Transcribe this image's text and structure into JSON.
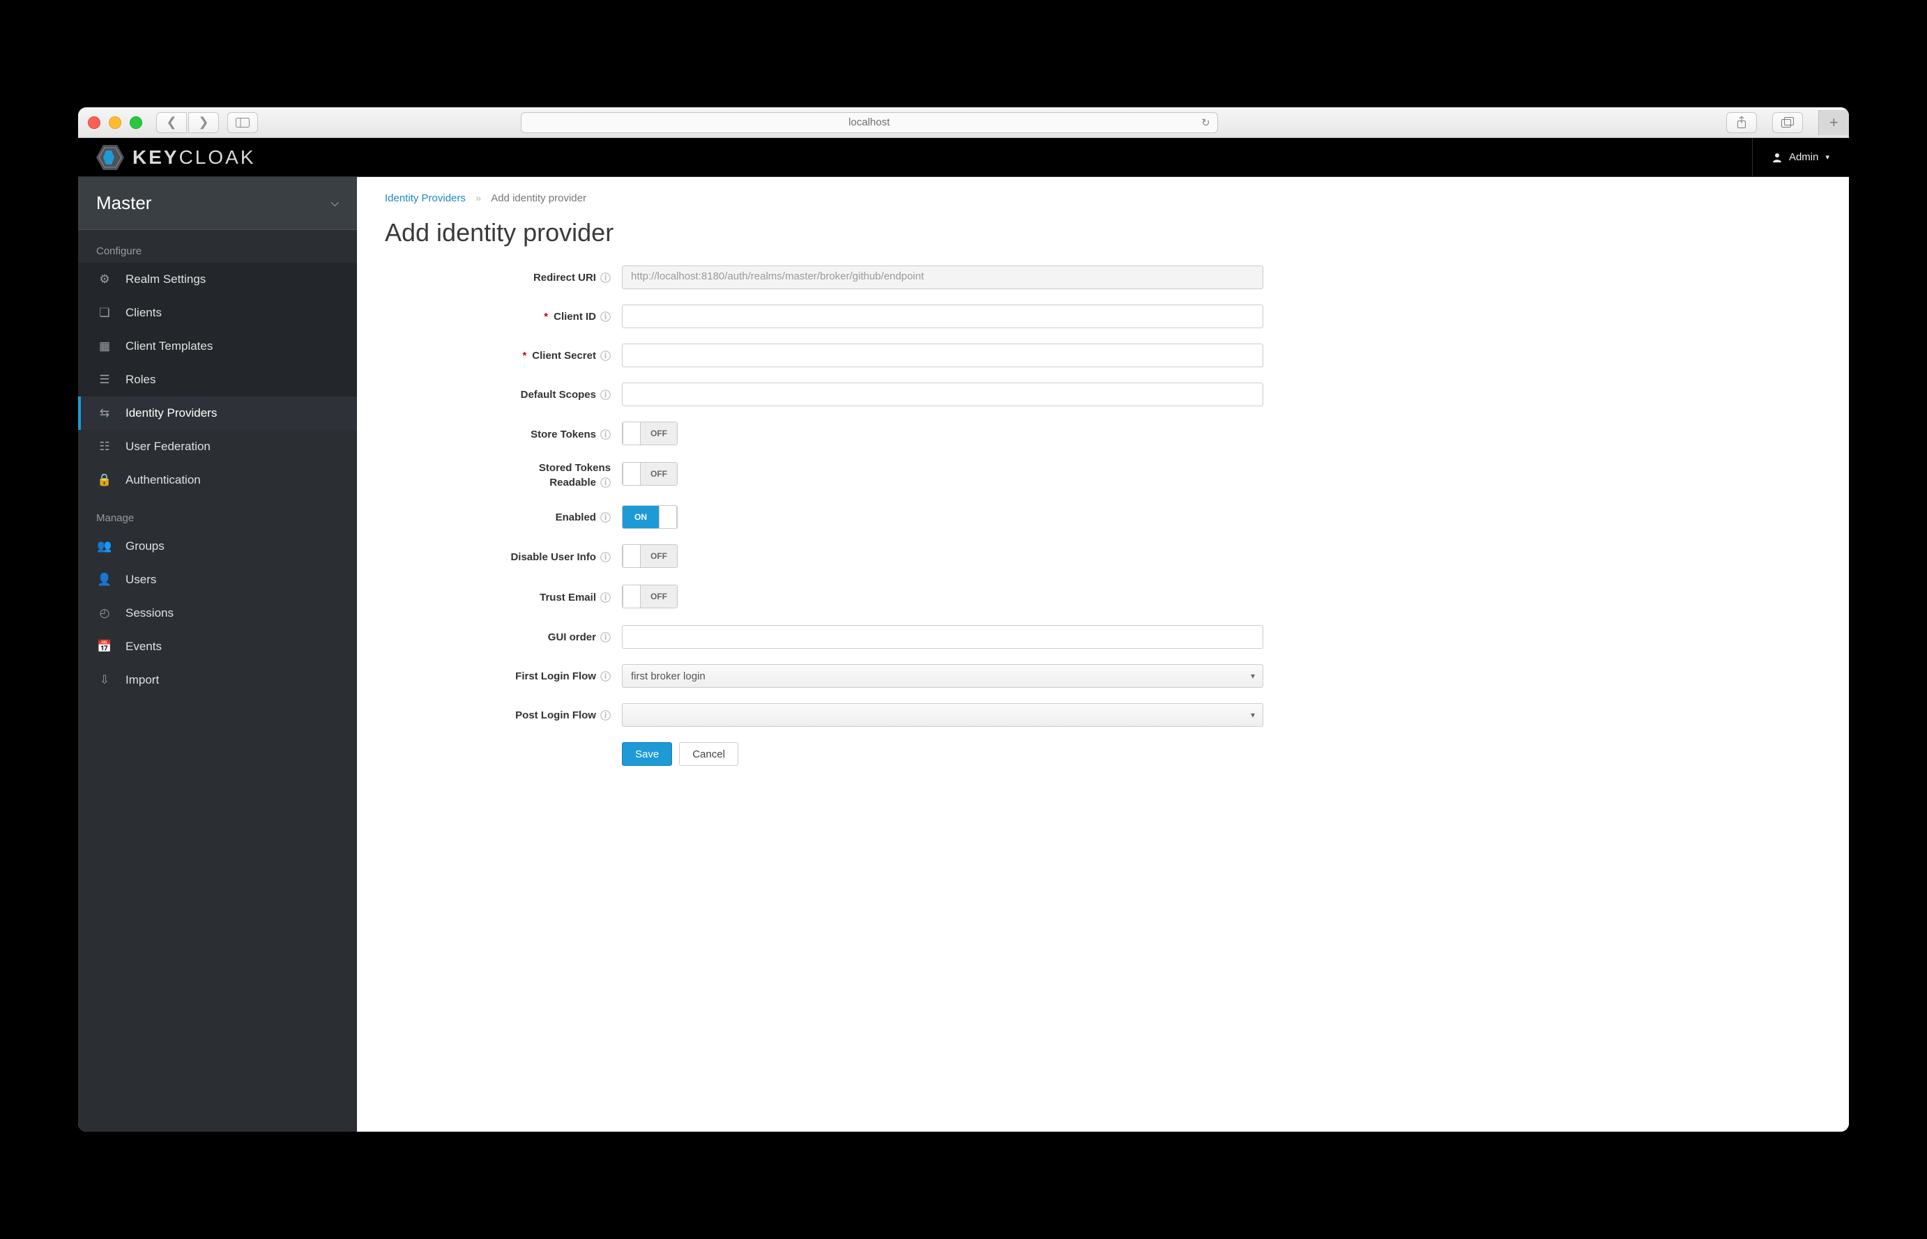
{
  "browser": {
    "url_display": "localhost"
  },
  "header": {
    "brand_left": "KEY",
    "brand_right": "CLOAK",
    "user_label": "Admin"
  },
  "sidebar": {
    "realm": "Master",
    "sections": {
      "configure": "Configure",
      "manage": "Manage"
    },
    "configure_items": [
      "Realm Settings",
      "Clients",
      "Client Templates",
      "Roles",
      "Identity Providers",
      "User Federation",
      "Authentication"
    ],
    "manage_items": [
      "Groups",
      "Users",
      "Sessions",
      "Events",
      "Import"
    ]
  },
  "breadcrumbs": {
    "root": "Identity Providers",
    "current": "Add identity provider"
  },
  "page": {
    "title": "Add identity provider"
  },
  "form": {
    "redirect_uri": {
      "label": "Redirect URI",
      "value": "http://localhost:8180/auth/realms/master/broker/github/endpoint"
    },
    "client_id": {
      "label": "Client ID",
      "value": ""
    },
    "client_secret": {
      "label": "Client Secret",
      "value": ""
    },
    "default_scopes": {
      "label": "Default Scopes",
      "value": ""
    },
    "store_tokens": {
      "label": "Store Tokens",
      "state": "OFF"
    },
    "stored_tokens_readable": {
      "label_l1": "Stored Tokens",
      "label_l2": "Readable",
      "state": "OFF"
    },
    "enabled": {
      "label": "Enabled",
      "state": "ON"
    },
    "disable_user_info": {
      "label": "Disable User Info",
      "state": "OFF"
    },
    "trust_email": {
      "label": "Trust Email",
      "state": "OFF"
    },
    "gui_order": {
      "label": "GUI order",
      "value": ""
    },
    "first_login_flow": {
      "label": "First Login Flow",
      "value": "first broker login"
    },
    "post_login_flow": {
      "label": "Post Login Flow",
      "value": ""
    },
    "save": "Save",
    "cancel": "Cancel",
    "on_text": "ON",
    "off_text": "OFF"
  }
}
